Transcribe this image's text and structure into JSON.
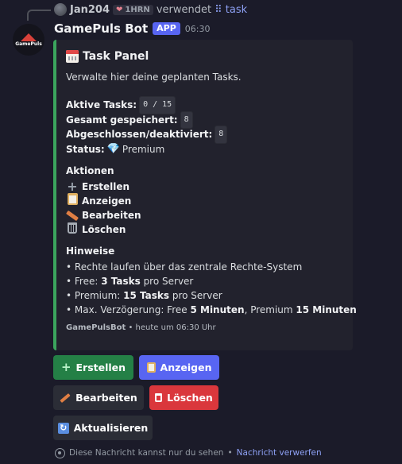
{
  "reply": {
    "username": "Jan204",
    "tag_label": "1HRN",
    "verb": "verwendet",
    "command": "task"
  },
  "message": {
    "bot_name": "GamePuls Bot",
    "app_badge": "APP",
    "time": "06:30",
    "avatar_text": "GamePuls"
  },
  "embed": {
    "accent_color": "#3ba55d",
    "title": "Task Panel",
    "description": "Verwalte hier deine geplanten Tasks.",
    "fields": [
      {
        "label": "Aktive Tasks:",
        "value": "0 / 15",
        "style": "code"
      },
      {
        "label": "Gesamt gespeichert:",
        "value": "8",
        "style": "code"
      },
      {
        "label": "Abgeschlossen/deaktiviert:",
        "value": "8",
        "style": "code"
      },
      {
        "label": "Status:",
        "value": "Premium",
        "style": "text",
        "icon": "gem-icon"
      }
    ],
    "actions_title": "Aktionen",
    "actions": [
      {
        "label": "Erstellen",
        "icon": "plus-icon"
      },
      {
        "label": "Anzeigen",
        "icon": "clipboard-icon"
      },
      {
        "label": "Bearbeiten",
        "icon": "pencil-icon"
      },
      {
        "label": "Löschen",
        "icon": "wastebasket-icon"
      }
    ],
    "hints_title": "Hinweise",
    "hints": [
      {
        "pre": "• Rechte laufen über das zentrale Rechte-System"
      },
      {
        "pre": "• Free: ",
        "bold": "3 Tasks",
        "post": " pro Server"
      },
      {
        "pre": "• Premium: ",
        "bold": "15 Tasks",
        "post": " pro Server"
      },
      {
        "pre": "• Max. Verzögerung: Free ",
        "bold": "5 Minuten",
        "mid": ", Premium ",
        "bold2": "15 Minuten"
      }
    ],
    "footer_name": "GamePulsBot",
    "footer_time": "heute um 06:30 Uhr"
  },
  "buttons": {
    "create": "Erstellen",
    "show": "Anzeigen",
    "edit": "Bearbeiten",
    "delete": "Löschen",
    "refresh": "Aktualisieren"
  },
  "ephemeral": {
    "notice": "Diese Nachricht kannst nur du sehen",
    "separator": "•",
    "dismiss": "Nachricht verwerfen"
  }
}
